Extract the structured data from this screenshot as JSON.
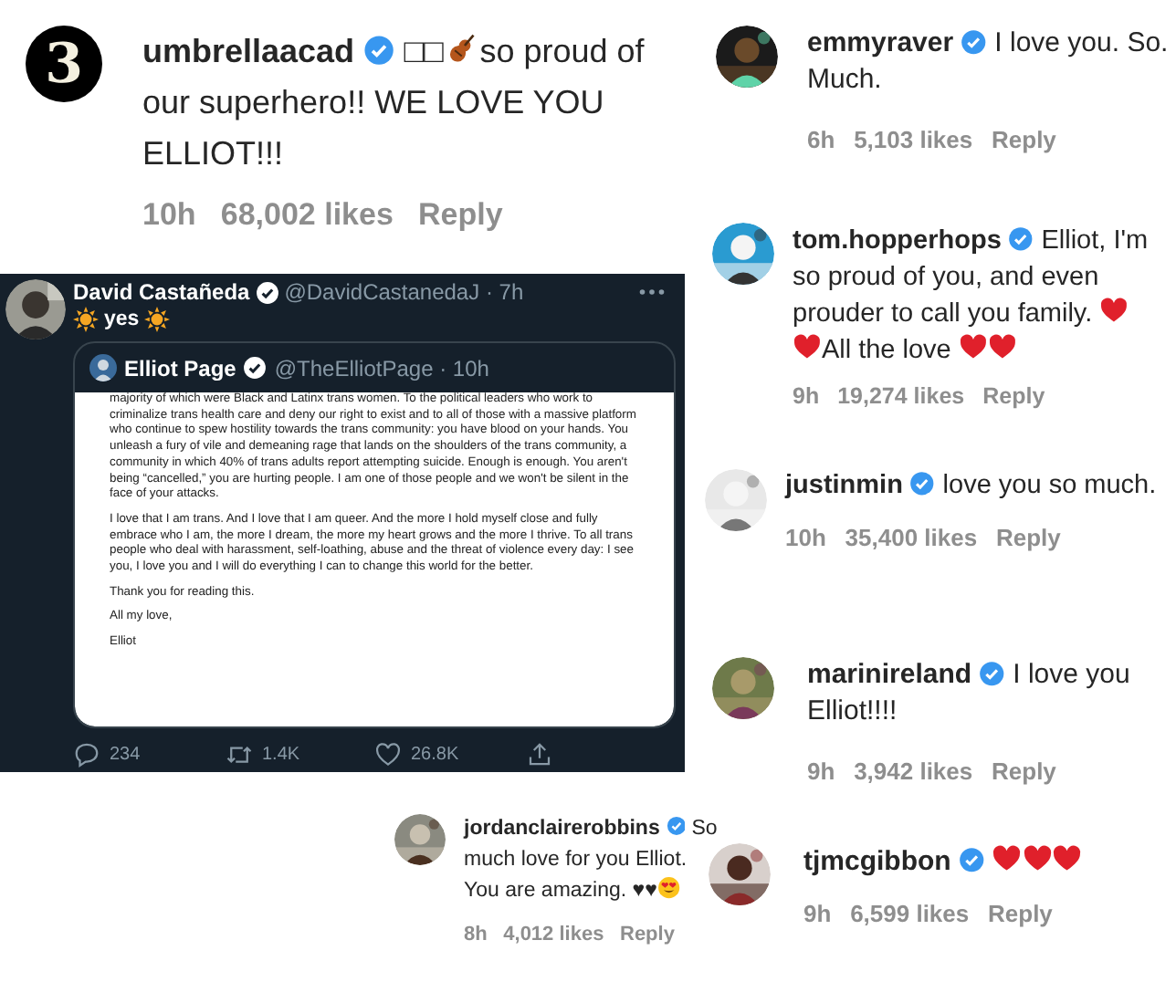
{
  "comments": [
    {
      "avatar": {
        "kind": "logo",
        "label": "3"
      },
      "username": "umbrellaacad",
      "verified": true,
      "body": [
        {
          "kind": "text",
          "text": "□□"
        },
        {
          "kind": "violin"
        },
        {
          "kind": "text",
          "text": "so proud of our superhero!! WE LOVE YOU ELLIOT!!!"
        }
      ],
      "time": "10h",
      "likes": "68,002 likes",
      "reply": "Reply"
    },
    {
      "avatar": {
        "kind": "picture"
      },
      "username": "emmyraver",
      "verified": true,
      "body": [
        {
          "kind": "text",
          "text": "I love you. So. Much."
        }
      ],
      "time": "6h",
      "likes": "5,103 likes",
      "reply": "Reply"
    },
    {
      "avatar": {
        "kind": "picture"
      },
      "username": "tom.hopperhops",
      "verified": true,
      "body": [
        {
          "kind": "text",
          "text": "Elliot, I'm so proud of you, and even prouder to call you family. "
        },
        {
          "kind": "heart"
        },
        {
          "kind": "heart"
        },
        {
          "kind": "text",
          "text": "All the love "
        },
        {
          "kind": "heart"
        },
        {
          "kind": "heart"
        }
      ],
      "time": "9h",
      "likes": "19,274 likes",
      "reply": "Reply"
    },
    {
      "avatar": {
        "kind": "picture"
      },
      "username": "justinmin",
      "verified": true,
      "body": [
        {
          "kind": "text",
          "text": "love you so much."
        }
      ],
      "time": "10h",
      "likes": "35,400 likes",
      "reply": "Reply"
    },
    {
      "avatar": {
        "kind": "picture"
      },
      "username": "marinireland",
      "verified": true,
      "body": [
        {
          "kind": "text",
          "text": "I love you Elliot!!!!"
        }
      ],
      "time": "9h",
      "likes": "3,942 likes",
      "reply": "Reply"
    },
    {
      "avatar": {
        "kind": "picture"
      },
      "username": "jordanclairerobbins",
      "verified": true,
      "body": [
        {
          "kind": "text",
          "text": "So much love for you Elliot. You are amazing. ♥♥"
        },
        {
          "kind": "heart_eyes"
        }
      ],
      "time": "8h",
      "likes": "4,012 likes",
      "reply": "Reply"
    },
    {
      "avatar": {
        "kind": "picture"
      },
      "username": "tjmcgibbon",
      "verified": true,
      "body": [
        {
          "kind": "heart"
        },
        {
          "kind": "heart"
        },
        {
          "kind": "heart"
        }
      ],
      "time": "9h",
      "likes": "6,599 likes",
      "reply": "Reply"
    }
  ],
  "tweet": {
    "name": "David Castañeda",
    "verified": true,
    "handle": "@DavidCastanedaJ · 7h",
    "text": [
      {
        "kind": "sun"
      },
      {
        "kind": "text",
        "text": "yes"
      },
      {
        "kind": "sun"
      }
    ],
    "quoted": {
      "name": "Elliot Page",
      "verified": true,
      "handle": "@TheElliotPage · 10h",
      "paragraphs": [
        "majority of which were Black and Latinx trans women. To the political leaders who work to criminalize trans health care and deny our right to exist and to all of those with a massive platform who continue to spew hostility towards the trans community: you have blood on your hands. You unleash a fury of vile and demeaning rage that lands on the shoulders of the trans community, a community in which 40% of trans adults report attempting suicide. Enough is enough. You aren't being “cancelled,” you are hurting people. I am one of those people and we won't be silent in the face of your attacks.",
        "I love that I am trans. And I love that I am queer. And the more I hold myself close and fully embrace who I am, the more I dream, the more my heart grows and the more I thrive. To all trans people who deal with harassment, self-loathing, abuse and the threat of violence every day: I see you, I love you and I will do everything I can to change this world for the better.",
        "Thank you for reading this.",
        "All my love,",
        "Elliot"
      ]
    },
    "actions": [
      {
        "kind": "reply",
        "label": "234"
      },
      {
        "kind": "retweet",
        "label": "1.4K"
      },
      {
        "kind": "like",
        "label": "26.8K"
      },
      {
        "kind": "share"
      }
    ]
  }
}
